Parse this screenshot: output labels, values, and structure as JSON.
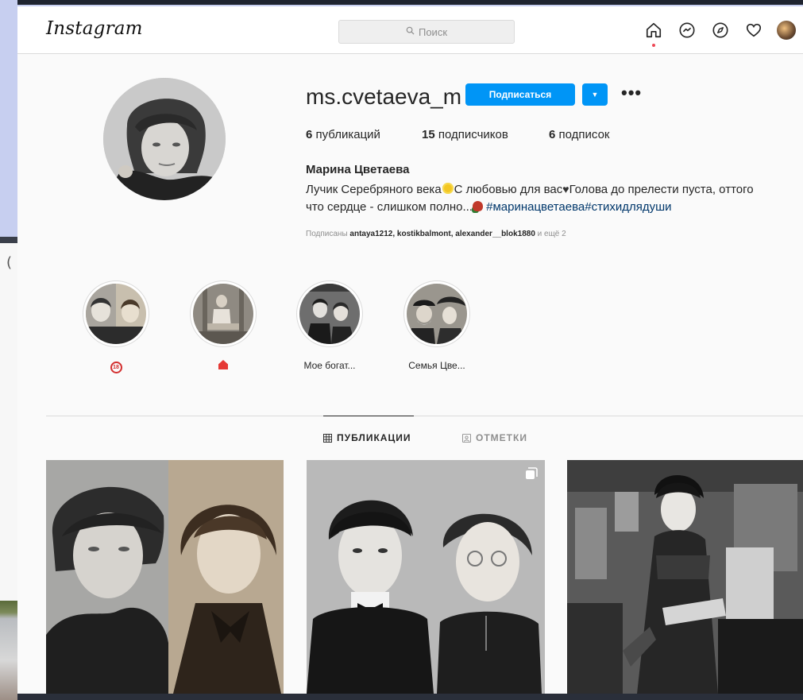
{
  "header": {
    "logo": "Instagram",
    "search_placeholder": "Поиск",
    "nav_icons": [
      "home-icon",
      "messenger-icon",
      "explore-icon",
      "heart-icon",
      "profile-avatar"
    ]
  },
  "profile": {
    "username": "ms.cvetaeva_m",
    "follow_label": "Подписаться",
    "stats": {
      "posts_count": "6",
      "posts_label": "публикаций",
      "followers_count": "15",
      "followers_label": "подписчиков",
      "following_count": "6",
      "following_label": "подписок"
    },
    "full_name": "Марина Цветаева",
    "bio": {
      "part1": "Лучик Серебряного века",
      "part2": "С любовью для вас",
      "part3": "Голова до прелести пуста, оттого",
      "part4": "что сердце - слишком полно...",
      "hashtags": "#маринацветаева#стихидлядуши"
    },
    "followed_by": {
      "prefix": "Подписаны",
      "users": "antaya1212, kostikbalmont, alexander__blok1880",
      "suffix": "и ещё 2"
    }
  },
  "highlights": [
    {
      "label": "",
      "badge": "18"
    },
    {
      "label": "",
      "badge": "house"
    },
    {
      "label": "Мое богат..."
    },
    {
      "label": "Семья Цве..."
    }
  ],
  "tabs": {
    "posts": "ПУБЛИКАЦИИ",
    "tagged": "ОТМЕТКИ"
  },
  "colors": {
    "accent": "#0095f6",
    "hashtag": "#00376b",
    "notification_dot": "#ed4956"
  }
}
